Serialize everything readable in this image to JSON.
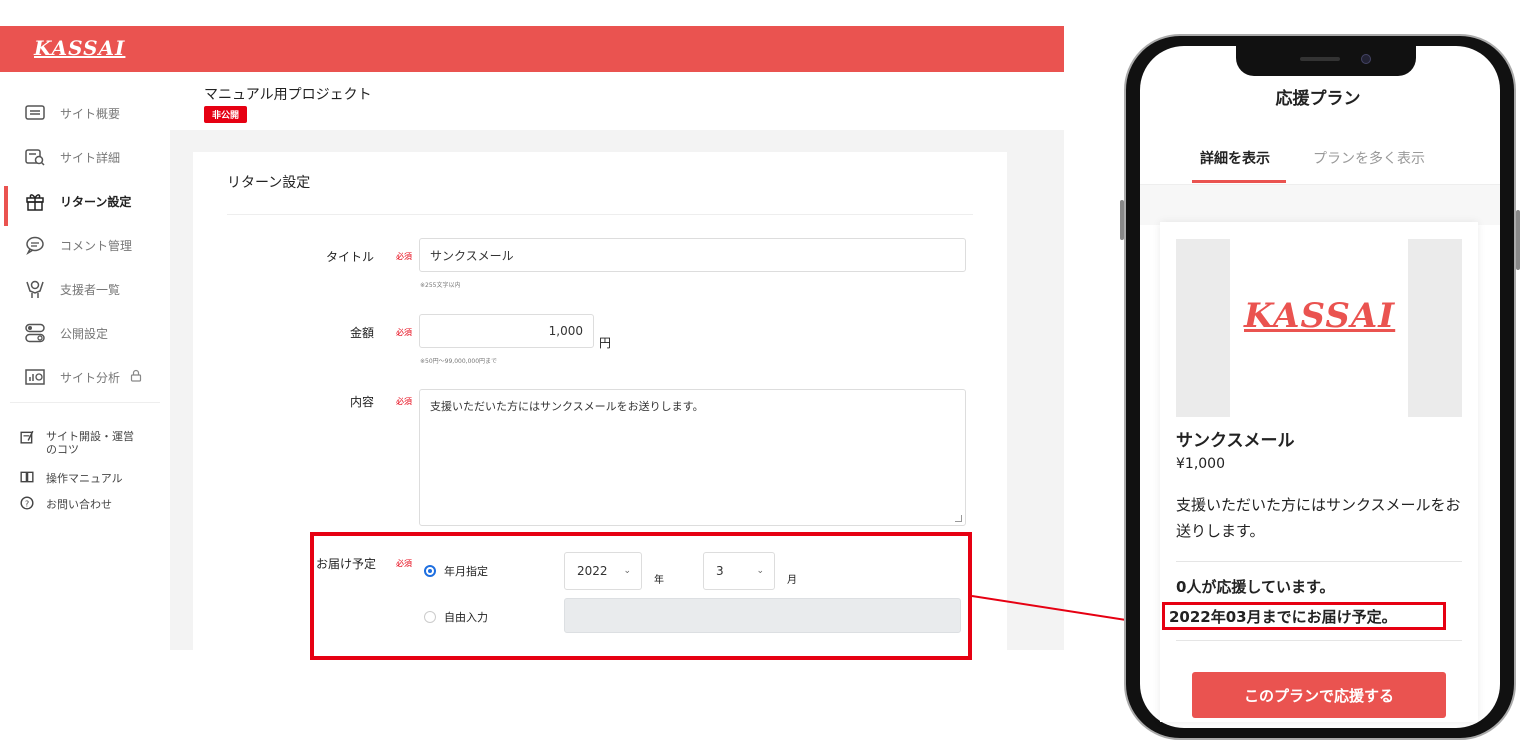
{
  "app": {
    "logo_text": "KASSAI"
  },
  "sidebar": {
    "items": [
      {
        "label": "サイト概要",
        "icon": "site-overview-icon"
      },
      {
        "label": "サイト詳細",
        "icon": "site-detail-icon"
      },
      {
        "label": "リターン設定",
        "icon": "gift-icon",
        "active": true
      },
      {
        "label": "コメント管理",
        "icon": "comment-icon"
      },
      {
        "label": "支援者一覧",
        "icon": "supporter-icon"
      },
      {
        "label": "公開設定",
        "icon": "toggle-icon"
      },
      {
        "label": "サイト分析",
        "icon": "chart-icon",
        "locked": true
      }
    ],
    "help_links": [
      {
        "label": "サイト開設・運営\nのコツ",
        "icon": "note-icon"
      },
      {
        "label": "操作マニュアル",
        "icon": "book-icon"
      },
      {
        "label": "お問い合わせ",
        "icon": "help-circle-icon"
      }
    ]
  },
  "header": {
    "project_title": "マニュアル用プロジェクト",
    "status_badge": "非公開"
  },
  "form": {
    "section_title": "リターン設定",
    "required_label": "必須",
    "title": {
      "label": "タイトル",
      "value": "サンクスメール",
      "hint": "※255文字以内"
    },
    "amount": {
      "label": "金額",
      "value": "1,000",
      "unit": "円",
      "hint": "※50円〜99,000,000円まで"
    },
    "content": {
      "label": "内容",
      "value": "支援いただいた方にはサンクスメールをお送りします。"
    },
    "delivery": {
      "label": "お届け予定",
      "option_month": "年月指定",
      "option_free": "自由入力",
      "year": "2022",
      "year_unit": "年",
      "month": "3",
      "month_unit": "月"
    }
  },
  "mobile": {
    "page_title": "応援プラン",
    "tabs": [
      "詳細を表示",
      "プランを多く表示"
    ],
    "plan": {
      "logo_text": "KASSAI",
      "name": "サンクスメール",
      "price": "¥1,000",
      "description": "支援いただいた方にはサンクスメールをお送りします。",
      "supporters": "0人が応援しています。",
      "delivery": "2022年03月までにお届け予定。",
      "button": "このプランで応援する"
    }
  },
  "colors": {
    "brand": "#ea5350",
    "required": "#e60012",
    "radio_selected": "#1e6fe0",
    "highlight": "#e60012"
  }
}
